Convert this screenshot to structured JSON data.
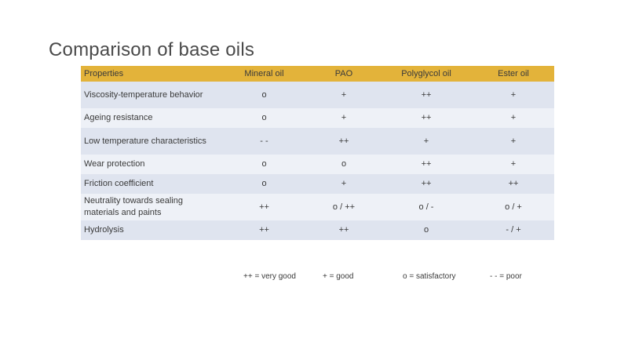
{
  "slide": {
    "title": "Comparison of base oils"
  },
  "table": {
    "columns": [
      "Properties",
      "Mineral oil",
      "PAO",
      "Polyglycol oil",
      "Ester oil"
    ],
    "rows": [
      {
        "property": "Viscosity-temperature behavior",
        "values": [
          "o",
          "+",
          "++",
          "+"
        ]
      },
      {
        "property": "Ageing resistance",
        "values": [
          "o",
          "+",
          "++",
          "+"
        ]
      },
      {
        "property": "Low temperature characteristics",
        "values": [
          "- -",
          "++",
          "+",
          "+"
        ]
      },
      {
        "property": "Wear protection",
        "values": [
          "o",
          "o",
          "++",
          "+"
        ]
      },
      {
        "property": "Friction coefficient",
        "values": [
          "o",
          "+",
          "++",
          "++"
        ]
      },
      {
        "property": "Neutrality towards sealing materials and paints",
        "values": [
          "++",
          "o / ++",
          "o / -",
          "o / +"
        ]
      },
      {
        "property": "Hydrolysis",
        "values": [
          "++",
          "++",
          "o",
          "- / +"
        ]
      }
    ]
  },
  "legend": {
    "very_good": "++ = very good",
    "good": "+ = good",
    "satisfactory": "o = satisfactory",
    "poor": "- - = poor"
  }
}
